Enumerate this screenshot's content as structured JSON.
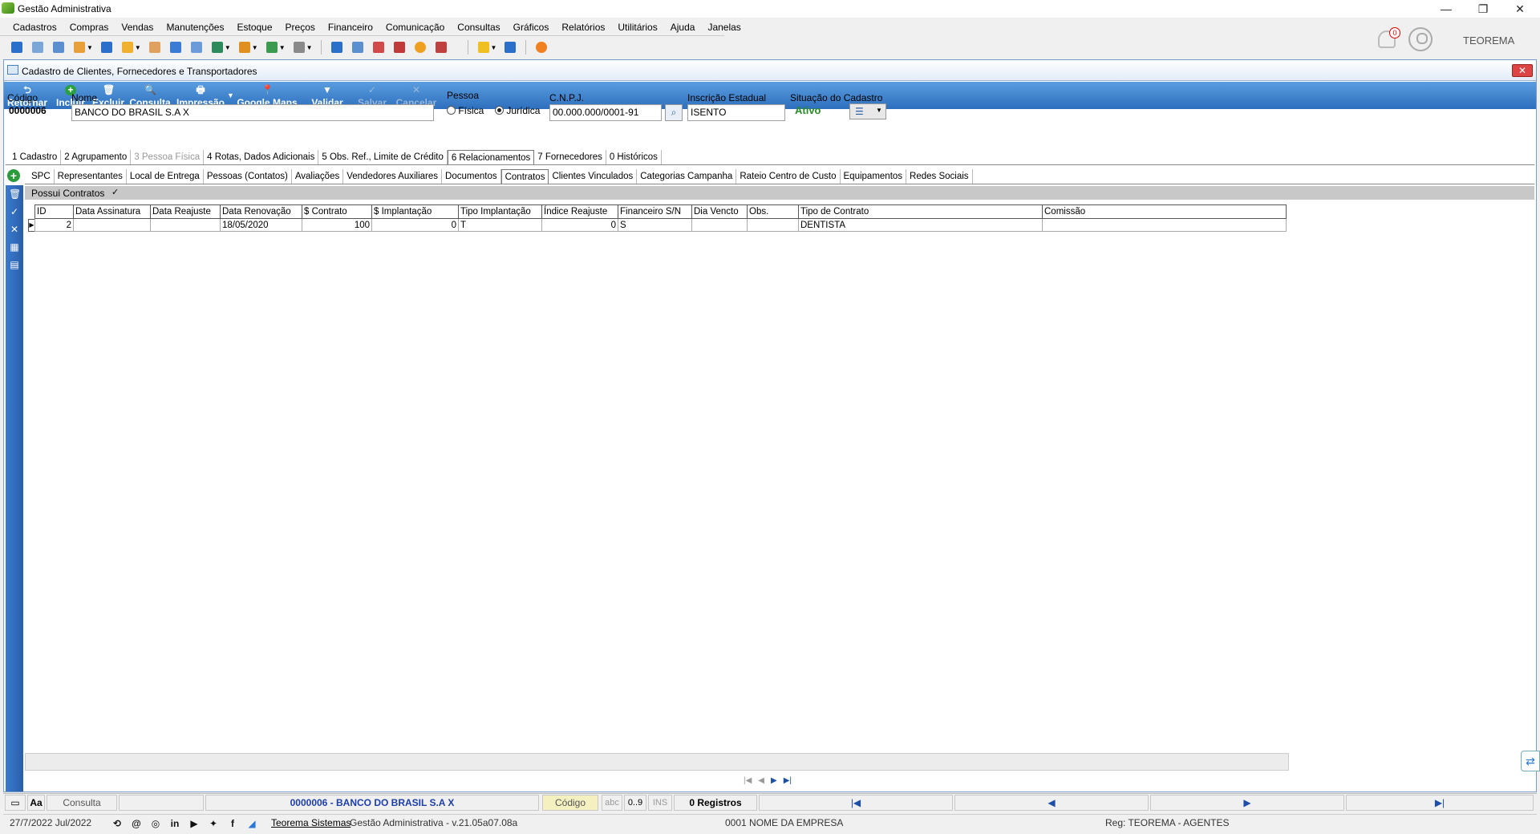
{
  "window": {
    "title": "Gestão Administrativa"
  },
  "menu": [
    "Cadastros",
    "Compras",
    "Vendas",
    "Manutenções",
    "Estoque",
    "Preços",
    "Financeiro",
    "Comunicação",
    "Consultas",
    "Gráficos",
    "Relatórios",
    "Utilitários",
    "Ajuda",
    "Janelas"
  ],
  "header": {
    "notification_count": "0",
    "user": "TEOREMA"
  },
  "form": {
    "title": "Cadastro de Clientes, Fornecedores e Transportadores",
    "ribbon": {
      "retornar": "Retornar",
      "incluir": "Incluir",
      "excluir": "Excluir",
      "consulta": "Consulta",
      "impressao": "Impressão",
      "google_maps": "Google Maps",
      "validar": "Validar",
      "salvar": "Salvar",
      "cancelar": "Cancelar"
    },
    "codigo_label": "Código",
    "codigo_value": "0000006",
    "nome_label": "Nome",
    "nome_value": "BANCO DO BRASIL S.A X",
    "pessoa_label": "Pessoa",
    "pessoa_fisica": "Física",
    "pessoa_juridica": "Jurídica",
    "cnpj_label": "C.N.P.J.",
    "cnpj_value": "00.000.000/0001-91",
    "ie_label": "Inscrição Estadual",
    "ie_value": "ISENTO",
    "situacao_label": "Situação do Cadastro",
    "situacao_value": "Ativo"
  },
  "tabs_main": [
    "1 Cadastro",
    "2 Agrupamento",
    "3 Pessoa Física",
    "4 Rotas, Dados Adicionais",
    "5 Obs. Ref., Limite de Crédito",
    "6 Relacionamentos",
    "7 Fornecedores",
    "0 Históricos"
  ],
  "tabs_sub": [
    "SPC",
    "Representantes",
    "Local de Entrega",
    "Pessoas (Contatos)",
    "Avaliações",
    "Vendedores Auxiliares",
    "Documentos",
    "Contratos",
    "Clientes Vinculados",
    "Categorias Campanha",
    "Rateio Centro de Custo",
    "Equipamentos",
    "Redes Sociais"
  ],
  "contracts": {
    "possui_label": "Possui Contratos",
    "possui_checked": "✓",
    "columns": [
      "ID",
      "Data Assinatura",
      "Data Reajuste",
      "Data Renovação",
      "$ Contrato",
      "$ Implantação",
      "Tipo Implantação",
      "Índice Reajuste",
      "Financeiro S/N",
      "Dia Vencto",
      "Obs.",
      "Tipo de Contrato",
      "Comissão"
    ],
    "rows": [
      [
        "2",
        "",
        "",
        "18/05/2020",
        "100",
        "0",
        "T",
        "0",
        "S",
        "",
        "",
        "DENTISTA",
        ""
      ]
    ]
  },
  "status1": {
    "aa": "Aa",
    "mode": "Consulta",
    "record": "0000006 - BANCO DO BRASIL S.A X",
    "order": "Código",
    "abc": "abc",
    "num": "0..9",
    "ins": "INS",
    "count": "0 Registros"
  },
  "status2": {
    "date": "27/7/2022 Jul/2022",
    "company_link": "Teorema Sistemas",
    "version": "Gestão Administrativa - v.21.05a07.08a",
    "empresa": "0001 NOME DA EMPRESA",
    "reg": "Reg: TEOREMA - AGENTES"
  }
}
